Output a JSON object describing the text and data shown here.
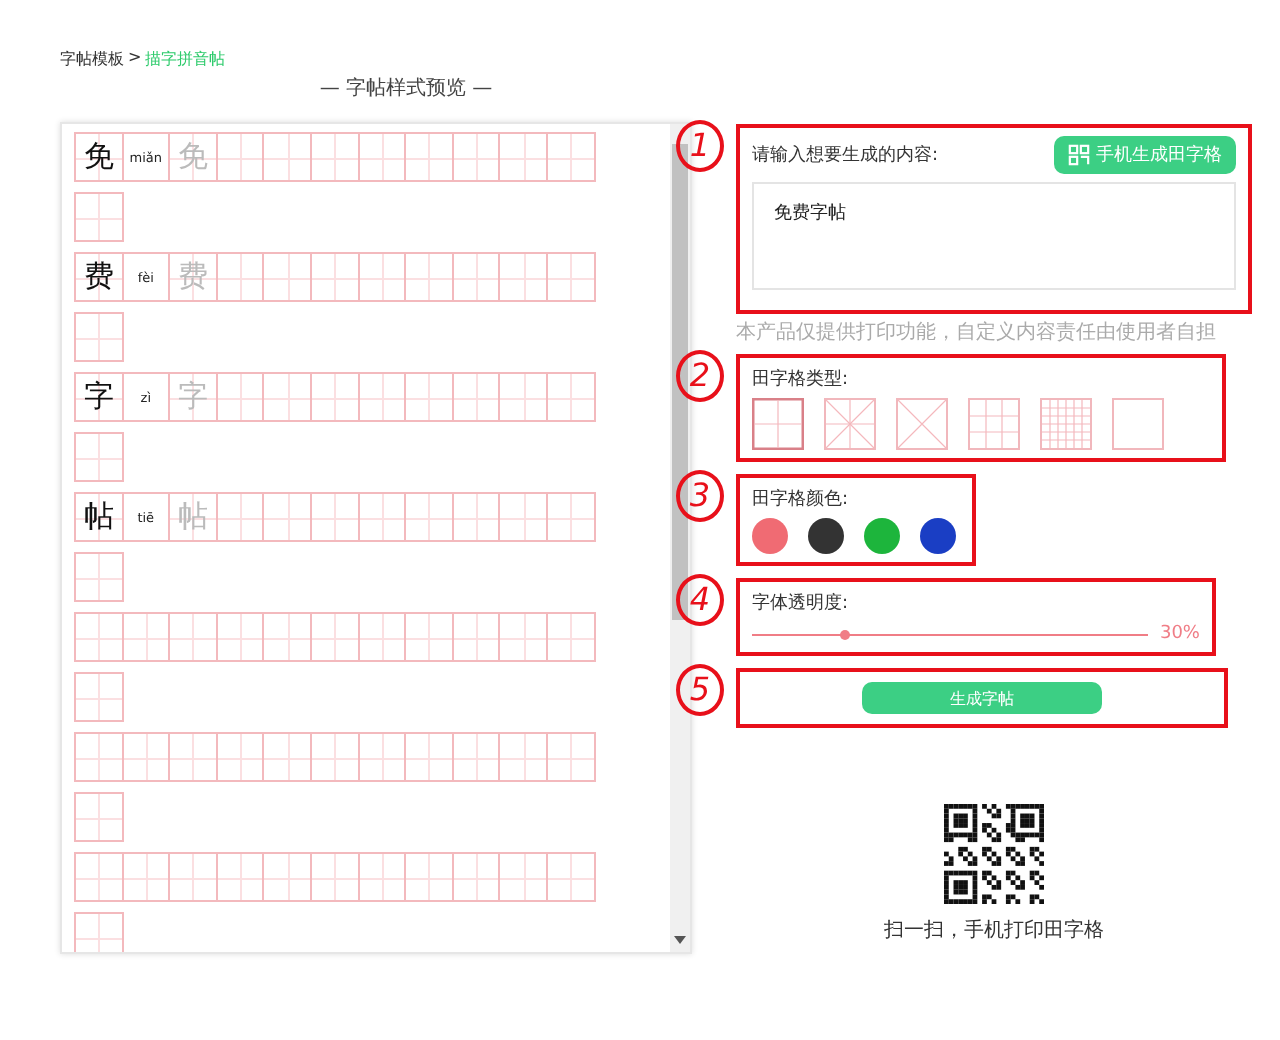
{
  "breadcrumb": {
    "parent": "字帖模板",
    "separator": ">",
    "current": "描字拼音帖"
  },
  "preview_title": "— 字帖样式预览 —",
  "practice_sheet": {
    "rows": [
      {
        "kind": "character",
        "char": "免",
        "pinyin": "miǎn",
        "trace": "免"
      },
      {
        "kind": "character",
        "char": "费",
        "pinyin": "fèi",
        "trace": "费"
      },
      {
        "kind": "character",
        "char": "字",
        "pinyin": "zì",
        "trace": "字"
      },
      {
        "kind": "character",
        "char": "帖",
        "pinyin": "tiē",
        "trace": "帖"
      },
      {
        "kind": "blank"
      },
      {
        "kind": "blank"
      },
      {
        "kind": "blank"
      }
    ]
  },
  "content_section": {
    "marker": "1",
    "label": "请输入想要生成的内容:",
    "mobile_button": "手机生成田字格",
    "value": "免费字帖",
    "disclaimer": "本产品仅提供打印功能，自定义内容责任由使用者自担"
  },
  "grid_type_section": {
    "marker": "2",
    "label": "田字格类型:",
    "options": [
      {
        "kind": "tian",
        "selected": true
      },
      {
        "kind": "mi",
        "selected": false
      },
      {
        "kind": "cross",
        "selected": false
      },
      {
        "kind": "thirds",
        "selected": false
      },
      {
        "kind": "dense",
        "selected": false
      },
      {
        "kind": "blank",
        "selected": false
      }
    ]
  },
  "grid_color_section": {
    "marker": "3",
    "label": "田字格颜色:",
    "swatches": [
      {
        "color": "#f06b73"
      },
      {
        "color": "#333333"
      },
      {
        "color": "#1db53c"
      },
      {
        "color": "#1a3ec4"
      }
    ]
  },
  "opacity_section": {
    "marker": "4",
    "label": "字体透明度:",
    "level": 0.23,
    "reading": "30%"
  },
  "generate_section": {
    "marker": "5",
    "button": "生成字帖"
  },
  "qr": {
    "caption": "扫一扫，手机打印田字格"
  }
}
